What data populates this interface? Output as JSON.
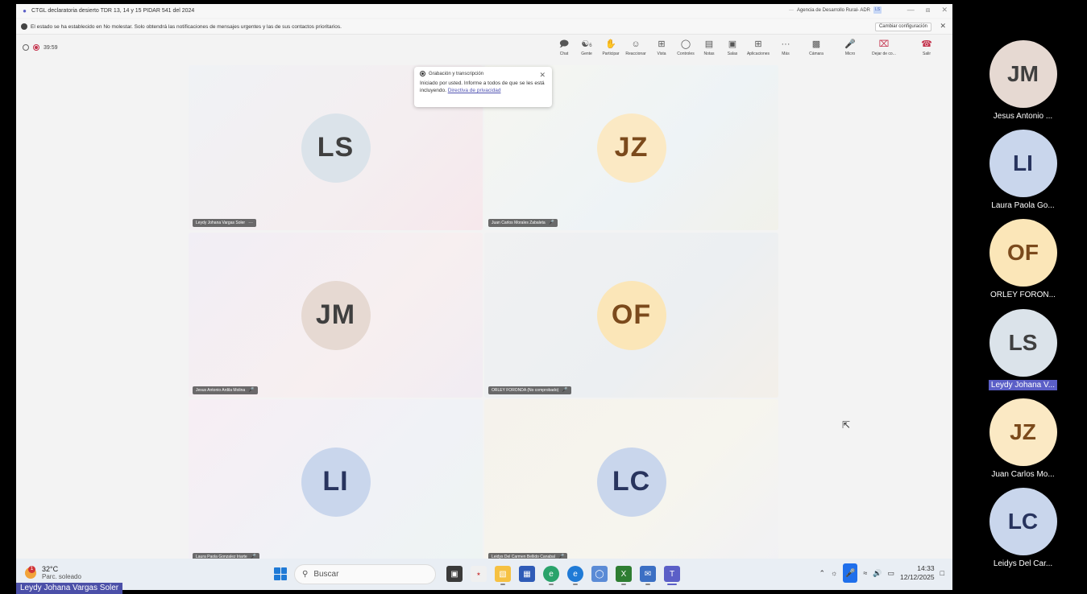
{
  "window": {
    "title": "CTGL declaratoria desierto TDR 13, 14 y 15 PIDAR 541 del 2024",
    "org": "Agencia de Desarrollo Rural- ADR"
  },
  "banner": {
    "text": "El estado se ha establecido en No molestar. Solo obtendrá las notificaciones de mensajes urgentes y las de sus contactos prioritarios.",
    "change_label": "Cambiar configuración"
  },
  "toolbar": {
    "timer": "39:59",
    "buttons": {
      "chat": "Chat",
      "people": "Gente",
      "raise": "Participar",
      "react": "Reaccionar",
      "view": "Vista",
      "controls": "Controles",
      "notes": "Notas",
      "rooms": "Salas",
      "apps": "Aplicaciones",
      "more": "Más",
      "camera": "Cámara",
      "mic": "Micro",
      "share": "Dejar de co...",
      "leave": "Salir"
    },
    "people_count": "6"
  },
  "rec_popup": {
    "title": "Grabación y transcripción",
    "body": "Iniciado por usted. Informe a todos de que se les está incluyendo.",
    "link": "Directiva de privacidad"
  },
  "tiles": [
    {
      "initials": "LS",
      "name": "Leydy Johana Vargas Soler"
    },
    {
      "initials": "JZ",
      "name": "Juan Carlos Morales Zabaleta"
    },
    {
      "initials": "JM",
      "name": "Jesus Antonio Ardila Molina"
    },
    {
      "initials": "OF",
      "name": "ORLEY FORONDA (No comprobado)"
    },
    {
      "initials": "LI",
      "name": "Laura Paola Gonzalez Iriarte"
    },
    {
      "initials": "LC",
      "name": "Leidys Del Carmen Bellido Canabal"
    }
  ],
  "taskbar": {
    "temp": "32°C",
    "condition": "Parc. soleado",
    "weather_badge": "1",
    "search_placeholder": "Buscar",
    "time": "14:33",
    "date": "12/12/2025"
  },
  "presenter_label": "Leydy Johana Vargas Soler",
  "strip": [
    {
      "initials": "JM",
      "name": "Jesus Antonio ..."
    },
    {
      "initials": "LI",
      "name": "Laura Paola Go..."
    },
    {
      "initials": "OF",
      "name": "ORLEY FORON..."
    },
    {
      "initials": "LS",
      "name": "Leydy Johana V..."
    },
    {
      "initials": "JZ",
      "name": "Juan Carlos Mo..."
    },
    {
      "initials": "LC",
      "name": "Leidys Del Car..."
    }
  ],
  "colors": {
    "LS": "#dbe3ea",
    "JZ": "#fbe9c4",
    "JM": "#e6d9d2",
    "OF": "#fbe6b8",
    "LI": "#c9d6ec",
    "LC": "#c9d6ec",
    "initials_text_dark": "#3f3f3f",
    "initials_text_brown": "#7b4a1c",
    "initials_text_blue": "#28345e",
    "brand": "#5b5fc7",
    "danger": "#c4314b"
  }
}
